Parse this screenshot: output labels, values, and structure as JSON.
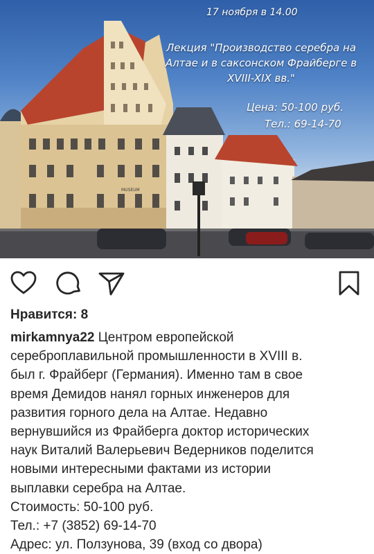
{
  "post": {
    "image_overlay": {
      "date": "17 ноября в 14.00",
      "title_lines": [
        "Лекция \"Производство серебра на",
        "Алтае и в саксонском Фрайберге в",
        "XVIII-XIX вв.\""
      ],
      "price": "Цена: 50-100 руб.",
      "phone": "Тел.: 69-14-70",
      "building_sign": "MUSEUM"
    },
    "actions": {
      "like_icon": "heart-icon",
      "comment_icon": "comment-icon",
      "share_icon": "share-icon",
      "save_icon": "bookmark-icon"
    },
    "likes": "Нравится: 8",
    "username": "mirkamnya22",
    "caption_first": " Центром европейской",
    "caption_lines": [
      "серебро­плавильной промышленности в XVIII в.",
      "был г. Фрайберг (Германия). Именно там в свое",
      "время Демидов нанял горных инженеров для",
      "развития горного дела на Алтае. Недавно",
      "вернувшийся из Фрайберга доктор исторических",
      "наук Виталий Валерьевич Ведерников поделится",
      "новыми интересными фактами из истории",
      "выплавки серебра на Алтае.",
      "Стоимость: 50-100 руб.",
      "Тел.: +7 (3852) 69-14-70",
      "Адрес: ул. Ползунова, 39 (вход со двора)"
    ]
  },
  "colors": {
    "text": "#262626",
    "sky_top": "#2f5fa8",
    "roof": "#b8442e"
  }
}
